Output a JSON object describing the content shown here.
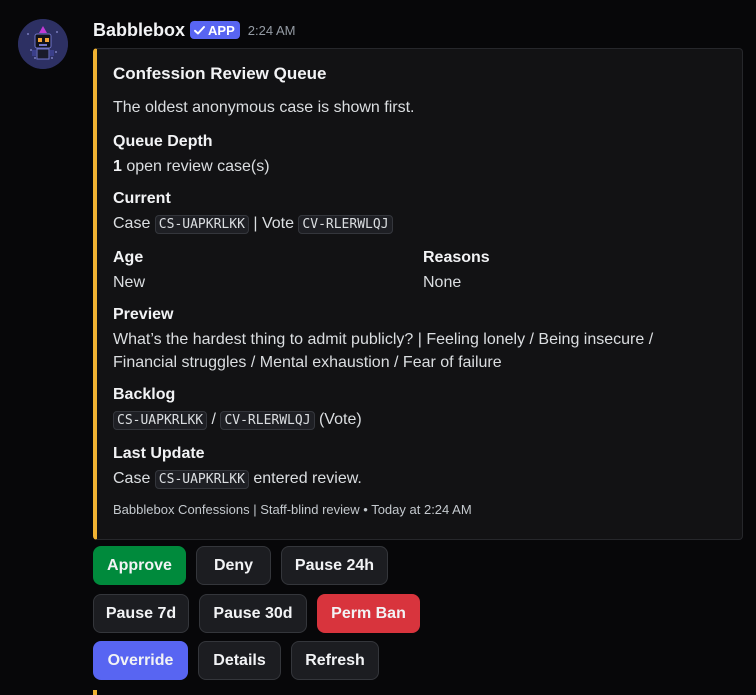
{
  "message": {
    "author": "Babblebox",
    "badge": "APP",
    "timestamp": "2:24 AM",
    "avatar_icon": "robot-icon"
  },
  "embed": {
    "accent_color": "#f0b232",
    "title": "Confession Review Queue",
    "description": "The oldest anonymous case is shown first.",
    "queue_depth": {
      "name": "Queue Depth",
      "count": "1",
      "suffix": " open review case(s)"
    },
    "current": {
      "name": "Current",
      "case_prefix": "Case ",
      "case_id": "CS-UAPKRLKK",
      "separator": " | Vote ",
      "vote_id": "CV-RLERWLQJ"
    },
    "age": {
      "name": "Age",
      "value": "New"
    },
    "reasons": {
      "name": "Reasons",
      "value": "None"
    },
    "preview": {
      "name": "Preview",
      "line1": "What’s the hardest thing to admit publicly? | Feeling lonely / Being insecure /",
      "line2": "Financial struggles / Mental exhaustion / Fear of failure"
    },
    "backlog": {
      "name": "Backlog",
      "case_id": "CS-UAPKRLKK",
      "separator": " / ",
      "vote_id": "CV-RLERWLQJ",
      "suffix": " (Vote)"
    },
    "last_update": {
      "name": "Last Update",
      "prefix": "Case ",
      "case_id": "CS-UAPKRLKK",
      "suffix": " entered review."
    },
    "footer": "Babblebox Confessions | Staff-blind review • Today at 2:24 AM"
  },
  "buttons": {
    "approve": "Approve",
    "deny": "Deny",
    "pause_24h": "Pause 24h",
    "pause_7d": "Pause 7d",
    "pause_30d": "Pause 30d",
    "perm_ban": "Perm Ban",
    "override": "Override",
    "details": "Details",
    "refresh": "Refresh"
  },
  "colors": {
    "success": "#008a3c",
    "danger": "#d8343d",
    "primary": "#5865f2",
    "secondary": "#1c1d21"
  }
}
